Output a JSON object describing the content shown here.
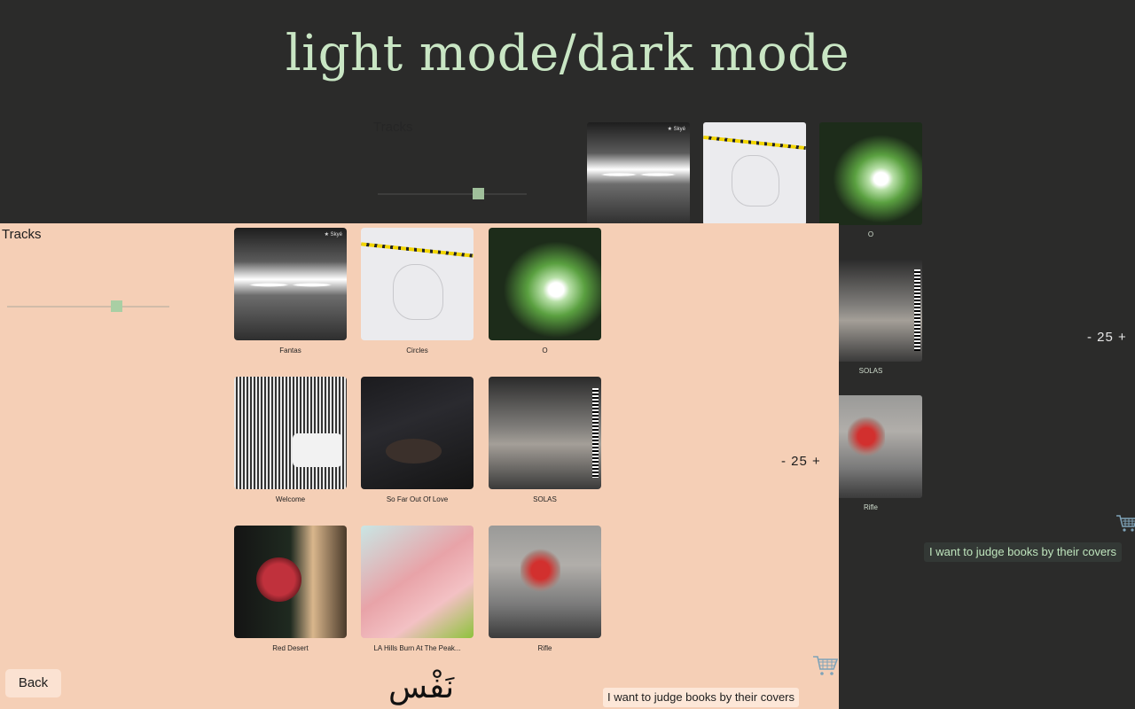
{
  "title": "light mode/dark mode",
  "dark_panel": {
    "tracks_label": "Tracks",
    "slider_value": 0.66,
    "tiles": [
      {
        "caption": "",
        "art": "art-fantas",
        "logo": "★ Skyé"
      },
      {
        "caption": "",
        "art": "art-circles"
      },
      {
        "caption": "O",
        "art": "art-o"
      },
      {
        "caption": "SOLAS",
        "art": "art-solas"
      },
      {
        "caption": "Rifle",
        "art": "art-rifle"
      }
    ],
    "counter": "- 25 +",
    "cart_icon": "shopping-cart-icon",
    "judge_text": "I want to judge books by their covers"
  },
  "light_panel": {
    "tracks_label": "Tracks",
    "slider_value": 0.66,
    "tiles": [
      {
        "caption": "Fantas",
        "art": "art-fantas",
        "logo": "★ Skyé"
      },
      {
        "caption": "Circles",
        "art": "art-circles"
      },
      {
        "caption": "O",
        "art": "art-o"
      },
      {
        "caption": "Welcome",
        "art": "art-welcome"
      },
      {
        "caption": "So Far Out Of Love",
        "art": "art-sofar"
      },
      {
        "caption": "SOLAS",
        "art": "art-solas"
      },
      {
        "caption": "Red Desert",
        "art": "art-redd"
      },
      {
        "caption": "LA Hills Burn At The Peak...",
        "art": "art-la"
      },
      {
        "caption": "Rifle",
        "art": "art-rifle"
      }
    ],
    "counter": "- 25 +",
    "cart_icon": "shopping-cart-icon",
    "back_label": "Back",
    "logo_text": "نَفْس",
    "judge_text": "I want to judge books by their covers"
  },
  "colors": {
    "dark_bg": "#2b2b2a",
    "light_bg": "#f5cfb6",
    "accent_green": "#c9e6c4"
  }
}
